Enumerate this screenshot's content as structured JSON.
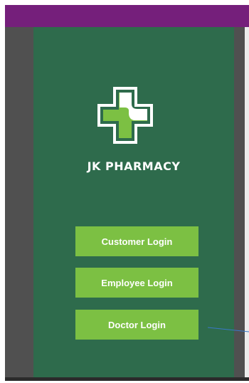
{
  "app": {
    "brand_name": "JK PHARMACY"
  },
  "buttons": {
    "customer_login": "Customer Login",
    "employee_login": "Employee Login",
    "doctor_login": "Doctor Login"
  },
  "icons": {
    "logo": "pharmacy-cross-icon"
  },
  "colors": {
    "title_bar": "#751f7b",
    "panel": "#2e6b4c",
    "button": "#7cc043",
    "frame": "#505050",
    "connector_line": "#3a78c8"
  }
}
